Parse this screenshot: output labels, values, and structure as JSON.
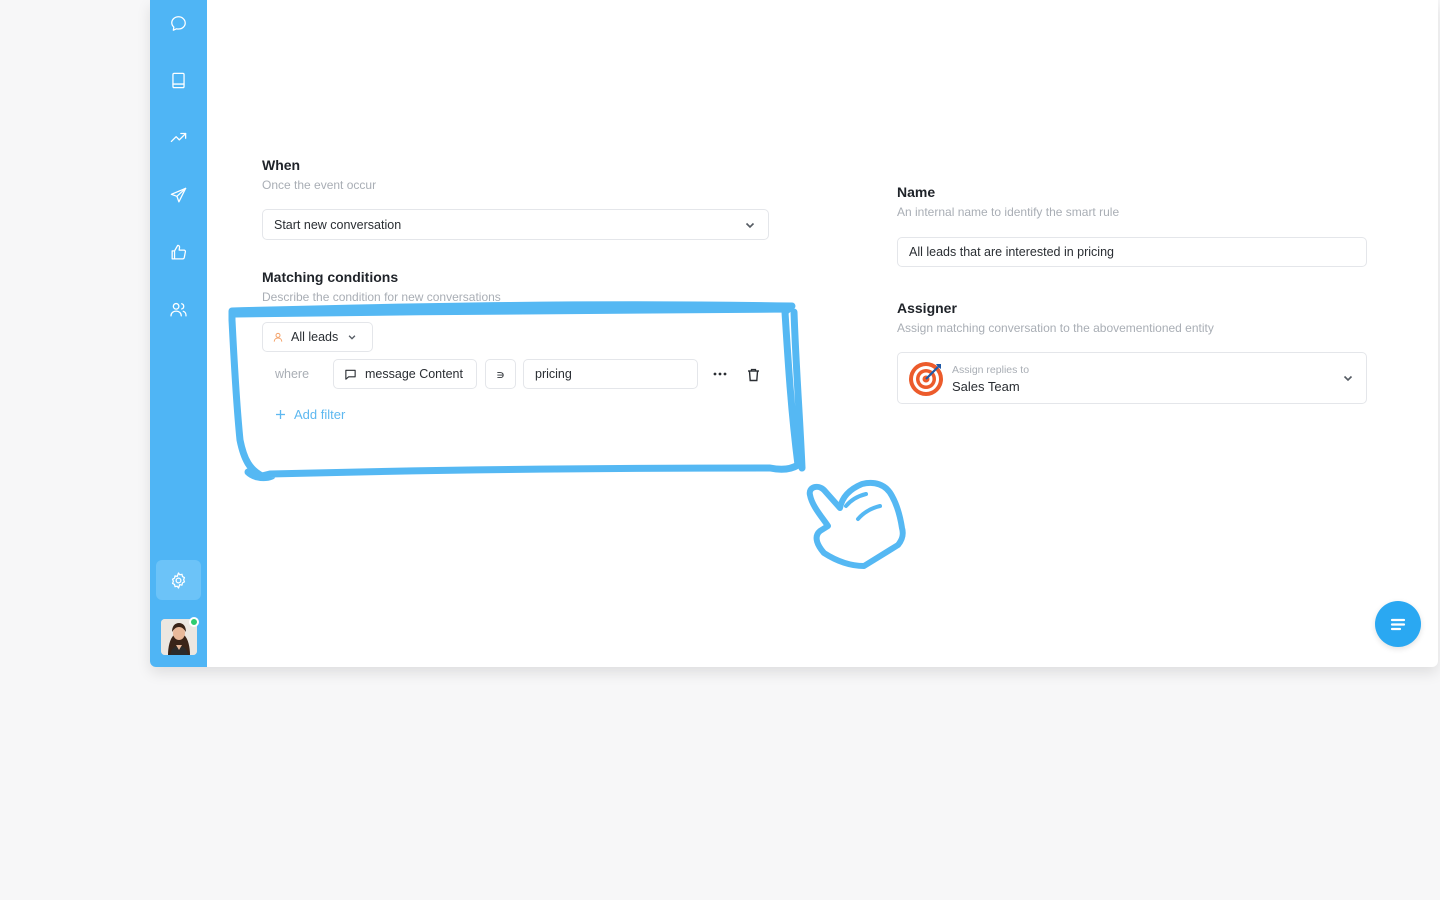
{
  "when": {
    "title": "When",
    "subtitle": "Once the event occur",
    "selected": "Start new conversation"
  },
  "conditions": {
    "title": "Matching conditions",
    "subtitle": "Describe the condition for new conversations",
    "segment": "All leads",
    "where_label": "where",
    "field": "message Content",
    "operator": "∍",
    "value": "pricing",
    "add_filter": "Add filter"
  },
  "name": {
    "title": "Name",
    "subtitle": "An internal name to identify the smart rule",
    "value": "All leads that are interested in pricing"
  },
  "assigner": {
    "title": "Assigner",
    "subtitle": "Assign matching conversation to the abovementioned entity",
    "caption": "Assign replies to",
    "value": "Sales Team"
  },
  "sidebar": {
    "items": [
      {
        "icon": "chat-bubble-icon"
      },
      {
        "icon": "book-icon"
      },
      {
        "icon": "trending-up-icon"
      },
      {
        "icon": "send-icon"
      },
      {
        "icon": "thumbs-up-icon"
      },
      {
        "icon": "users-icon"
      },
      {
        "icon": "gear-icon",
        "active": true
      }
    ]
  },
  "colors": {
    "sidebar": "#4fb5f5",
    "accent": "#2aa8f2",
    "highlight": "#55b8f3",
    "online": "#2ecc71"
  }
}
